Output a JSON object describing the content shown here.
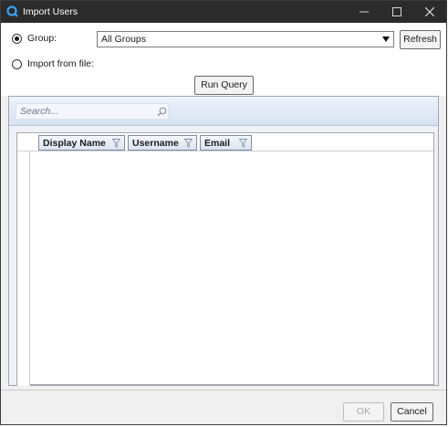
{
  "window": {
    "title": "Import Users",
    "accent_color": "#2b2b2b",
    "app_icon": "app-logo-icon"
  },
  "source": {
    "group_label": "Group:",
    "group_selected": true,
    "group_value": "All Groups",
    "file_label": "Import from file:",
    "file_selected": false,
    "refresh_label": "Refresh",
    "run_query_label": "Run Query"
  },
  "search": {
    "placeholder": "Search..."
  },
  "grid": {
    "columns": [
      "Display Name",
      "Username",
      "Email"
    ],
    "rows": []
  },
  "footer": {
    "ok_label": "OK",
    "ok_enabled": false,
    "cancel_label": "Cancel"
  }
}
